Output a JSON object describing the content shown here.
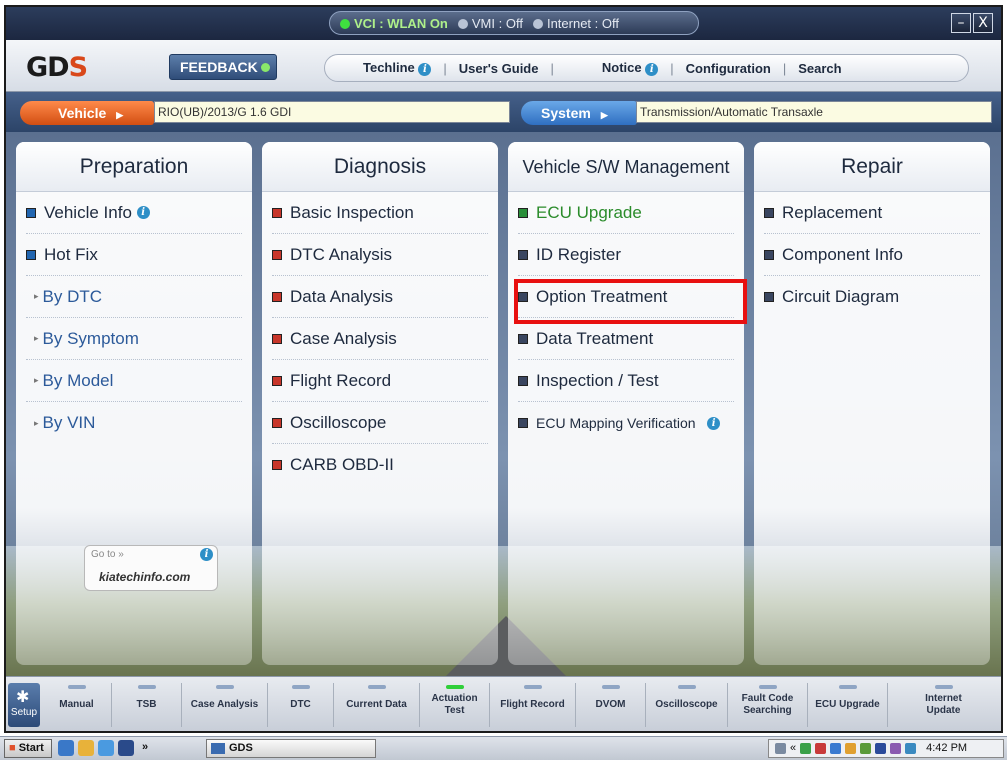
{
  "status": {
    "vci": "VCI : WLAN On",
    "vmi": "VMI : Off",
    "internet": "Internet : Off"
  },
  "window_controls": {
    "minimize": "–",
    "close": "X"
  },
  "header": {
    "logo": "GD",
    "feedback": "FEEDBACK",
    "nav": [
      {
        "label": "Techline",
        "info": true
      },
      {
        "label": "User's Guide",
        "info": false
      },
      {
        "label": "Notice",
        "info": true
      },
      {
        "label": "Configuration",
        "info": false
      },
      {
        "label": "Search",
        "info": false
      }
    ]
  },
  "vehicle_bar": {
    "vehicle_label": "Vehicle",
    "vehicle_value": "RIO(UB)/2013/G 1.6 GDI",
    "system_label": "System",
    "system_value": "Transmission/Automatic Transaxle"
  },
  "columns": [
    {
      "title": "Preparation",
      "items": [
        {
          "label": "Vehicle Info",
          "type": "main",
          "info": true
        },
        {
          "label": "Hot Fix",
          "type": "main"
        },
        {
          "label": "By DTC",
          "type": "sub"
        },
        {
          "label": "By Symptom",
          "type": "sub"
        },
        {
          "label": "By Model",
          "type": "sub"
        },
        {
          "label": "By VIN",
          "type": "sub"
        }
      ]
    },
    {
      "title": "Diagnosis",
      "items": [
        {
          "label": "Basic Inspection"
        },
        {
          "label": "DTC Analysis"
        },
        {
          "label": "Data Analysis"
        },
        {
          "label": "Case Analysis"
        },
        {
          "label": "Flight Record"
        },
        {
          "label": "Oscilloscope"
        },
        {
          "label": "CARB OBD-II"
        }
      ]
    },
    {
      "title": "Vehicle S/W Management",
      "items": [
        {
          "label": "ECU Upgrade"
        },
        {
          "label": "ID Register"
        },
        {
          "label": "Option Treatment"
        },
        {
          "label": "Data Treatment"
        },
        {
          "label": "Inspection / Test"
        },
        {
          "label": "ECU Mapping Verification",
          "info": true
        }
      ]
    },
    {
      "title": "Repair",
      "items": [
        {
          "label": "Replacement"
        },
        {
          "label": "Component Info"
        },
        {
          "label": "Circuit Diagram"
        }
      ]
    }
  ],
  "kia_badge": {
    "goto": "Go to »",
    "url": "kiatechinfo.com"
  },
  "bottom_tools": {
    "setup": "Setup",
    "items": [
      "Manual",
      "TSB",
      "Case Analysis",
      "DTC",
      "Current Data",
      "Actuation Test",
      "Flight Record",
      "DVOM",
      "Oscilloscope",
      "Fault Code Searching",
      "ECU Upgrade",
      "Internet Update"
    ]
  },
  "taskbar": {
    "start": "Start",
    "chevron": "»",
    "app": "GDS",
    "time": "4:42 PM"
  },
  "colors": {
    "highlight": "#e81010",
    "vehicle_button": "#e8621d",
    "system_button": "#3a7fd0",
    "active_lamp": "#2fcf3a"
  }
}
